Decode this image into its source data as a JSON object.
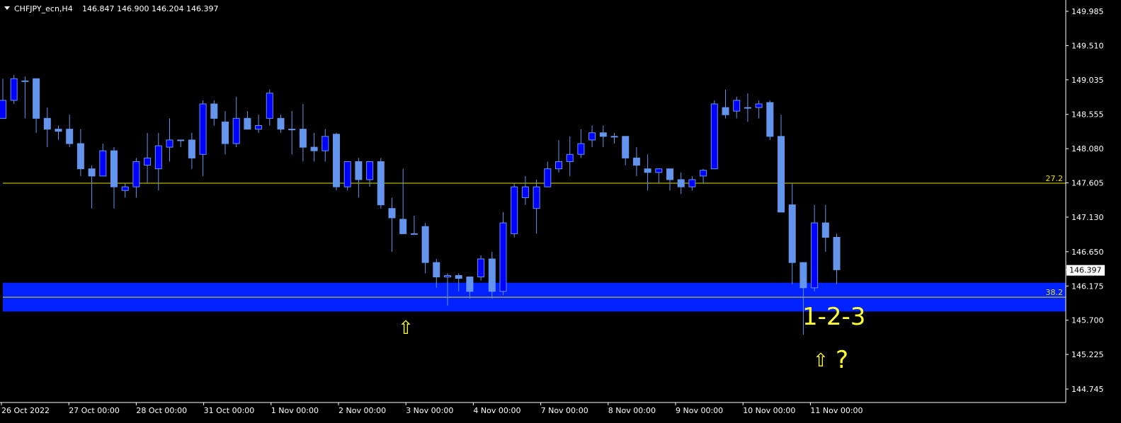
{
  "header": {
    "symbol": "CHFJPY_ecn,H4",
    "ohlc": "146.847 146.900 146.204 146.397"
  },
  "colors": {
    "background": "#000000",
    "bull_fill": "#0000ff",
    "bear_fill": "#6495ed",
    "wick": "#6495ed",
    "zone": "#0022ff",
    "level_line": "#e8e000",
    "annotation": "#ffff33",
    "axis": "#ffffff"
  },
  "annotations": {
    "pattern_label": "1-2-3",
    "question": "?",
    "arrow_glyph": "⇧"
  },
  "chart_data": {
    "type": "candlestick",
    "symbol": "CHFJPY_ecn",
    "timeframe": "H4",
    "ylim": [
      144.5,
      150.2
    ],
    "y_ticks": [
      "149.985",
      "149.510",
      "149.035",
      "148.555",
      "148.080",
      "147.605",
      "147.130",
      "146.650",
      "146.175",
      "145.700",
      "145.225",
      "144.745"
    ],
    "x_ticks": [
      "26 Oct 2022",
      "27 Oct 00:00",
      "28 Oct 00:00",
      "31 Oct 00:00",
      "1 Nov 00:00",
      "2 Nov 00:00",
      "3 Nov 00:00",
      "4 Nov 00:00",
      "7 Nov 00:00",
      "8 Nov 00:00",
      "9 Nov 00:00",
      "10 Nov 00:00",
      "11 Nov 00:00"
    ],
    "current_price": "146.397",
    "levels": [
      {
        "label": "27.2",
        "price": 147.6
      },
      {
        "label": "38.2",
        "price": 146.02
      }
    ],
    "zone": {
      "top": 146.22,
      "bottom": 145.82
    },
    "candles": [
      {
        "o": 148.5,
        "h": 149.05,
        "l": 148.5,
        "c": 148.75
      },
      {
        "o": 148.75,
        "h": 149.1,
        "l": 148.7,
        "c": 149.05
      },
      {
        "o": 149.02,
        "h": 149.08,
        "l": 148.5,
        "c": 149.02
      },
      {
        "o": 149.05,
        "h": 149.05,
        "l": 148.3,
        "c": 148.5
      },
      {
        "o": 148.5,
        "h": 148.65,
        "l": 148.1,
        "c": 148.35
      },
      {
        "o": 148.35,
        "h": 148.4,
        "l": 148.2,
        "c": 148.32
      },
      {
        "o": 148.35,
        "h": 148.55,
        "l": 148.1,
        "c": 148.15
      },
      {
        "o": 148.15,
        "h": 148.35,
        "l": 147.7,
        "c": 147.8
      },
      {
        "o": 147.8,
        "h": 147.85,
        "l": 147.25,
        "c": 147.7
      },
      {
        "o": 147.7,
        "h": 148.15,
        "l": 147.7,
        "c": 148.05
      },
      {
        "o": 148.05,
        "h": 148.1,
        "l": 147.25,
        "c": 147.55
      },
      {
        "o": 147.5,
        "h": 147.6,
        "l": 147.4,
        "c": 147.55
      },
      {
        "o": 147.55,
        "h": 147.95,
        "l": 147.4,
        "c": 147.9
      },
      {
        "o": 147.85,
        "h": 148.3,
        "l": 147.6,
        "c": 147.95
      },
      {
        "o": 147.8,
        "h": 148.3,
        "l": 147.5,
        "c": 148.12
      },
      {
        "o": 148.1,
        "h": 148.5,
        "l": 147.9,
        "c": 148.2
      },
      {
        "o": 148.2,
        "h": 148.2,
        "l": 148.1,
        "c": 148.2
      },
      {
        "o": 148.2,
        "h": 148.3,
        "l": 147.8,
        "c": 147.95
      },
      {
        "o": 148.0,
        "h": 148.75,
        "l": 147.7,
        "c": 148.7
      },
      {
        "o": 148.7,
        "h": 148.75,
        "l": 148.4,
        "c": 148.5
      },
      {
        "o": 148.45,
        "h": 148.6,
        "l": 148.0,
        "c": 148.15
      },
      {
        "o": 148.15,
        "h": 148.8,
        "l": 148.1,
        "c": 148.5
      },
      {
        "o": 148.5,
        "h": 148.6,
        "l": 148.35,
        "c": 148.35
      },
      {
        "o": 148.35,
        "h": 148.55,
        "l": 148.3,
        "c": 148.4
      },
      {
        "o": 148.5,
        "h": 148.9,
        "l": 148.4,
        "c": 148.85
      },
      {
        "o": 148.5,
        "h": 148.55,
        "l": 148.3,
        "c": 148.35
      },
      {
        "o": 148.35,
        "h": 148.6,
        "l": 148.0,
        "c": 148.35
      },
      {
        "o": 148.35,
        "h": 148.7,
        "l": 147.9,
        "c": 148.1
      },
      {
        "o": 148.1,
        "h": 148.3,
        "l": 147.9,
        "c": 148.05
      },
      {
        "o": 148.05,
        "h": 148.35,
        "l": 147.9,
        "c": 148.25
      },
      {
        "o": 148.28,
        "h": 148.3,
        "l": 147.5,
        "c": 147.55
      },
      {
        "o": 147.55,
        "h": 147.9,
        "l": 147.5,
        "c": 147.9
      },
      {
        "o": 147.9,
        "h": 147.95,
        "l": 147.4,
        "c": 147.65
      },
      {
        "o": 147.65,
        "h": 147.9,
        "l": 147.55,
        "c": 147.9
      },
      {
        "o": 147.9,
        "h": 147.95,
        "l": 147.25,
        "c": 147.3
      },
      {
        "o": 147.25,
        "h": 147.4,
        "l": 146.65,
        "c": 147.12
      },
      {
        "o": 147.1,
        "h": 147.8,
        "l": 146.95,
        "c": 146.9
      },
      {
        "o": 146.9,
        "h": 147.15,
        "l": 146.9,
        "c": 146.9
      },
      {
        "o": 147.0,
        "h": 147.05,
        "l": 146.35,
        "c": 146.5
      },
      {
        "o": 146.5,
        "h": 146.55,
        "l": 146.15,
        "c": 146.3
      },
      {
        "o": 146.3,
        "h": 146.35,
        "l": 145.9,
        "c": 146.32
      },
      {
        "o": 146.32,
        "h": 146.35,
        "l": 146.1,
        "c": 146.28
      },
      {
        "o": 146.3,
        "h": 146.3,
        "l": 146.0,
        "c": 146.1
      },
      {
        "o": 146.3,
        "h": 146.6,
        "l": 146.25,
        "c": 146.55
      },
      {
        "o": 146.55,
        "h": 146.65,
        "l": 146.0,
        "c": 146.1
      },
      {
        "o": 146.1,
        "h": 147.2,
        "l": 146.05,
        "c": 147.05
      },
      {
        "o": 146.9,
        "h": 147.6,
        "l": 146.85,
        "c": 147.55
      },
      {
        "o": 147.4,
        "h": 147.7,
        "l": 147.3,
        "c": 147.55
      },
      {
        "o": 147.25,
        "h": 147.65,
        "l": 146.9,
        "c": 147.55
      },
      {
        "o": 147.55,
        "h": 147.9,
        "l": 147.55,
        "c": 147.8
      },
      {
        "o": 147.8,
        "h": 148.2,
        "l": 147.75,
        "c": 147.9
      },
      {
        "o": 147.9,
        "h": 148.25,
        "l": 147.7,
        "c": 148.0
      },
      {
        "o": 148.0,
        "h": 148.35,
        "l": 147.95,
        "c": 148.15
      },
      {
        "o": 148.2,
        "h": 148.4,
        "l": 148.1,
        "c": 148.3
      },
      {
        "o": 148.3,
        "h": 148.4,
        "l": 148.1,
        "c": 148.25
      },
      {
        "o": 148.25,
        "h": 148.3,
        "l": 148.15,
        "c": 148.25
      },
      {
        "o": 148.25,
        "h": 148.25,
        "l": 147.85,
        "c": 147.95
      },
      {
        "o": 147.95,
        "h": 148.1,
        "l": 147.7,
        "c": 147.85
      },
      {
        "o": 147.8,
        "h": 148.0,
        "l": 147.5,
        "c": 147.75
      },
      {
        "o": 147.75,
        "h": 147.8,
        "l": 147.6,
        "c": 147.8
      },
      {
        "o": 147.8,
        "h": 147.8,
        "l": 147.5,
        "c": 147.65
      },
      {
        "o": 147.65,
        "h": 147.75,
        "l": 147.45,
        "c": 147.55
      },
      {
        "o": 147.55,
        "h": 147.7,
        "l": 147.5,
        "c": 147.65
      },
      {
        "o": 147.7,
        "h": 147.8,
        "l": 147.6,
        "c": 147.78
      },
      {
        "o": 147.8,
        "h": 148.75,
        "l": 147.8,
        "c": 148.7
      },
      {
        "o": 148.65,
        "h": 148.9,
        "l": 148.5,
        "c": 148.55
      },
      {
        "o": 148.6,
        "h": 148.8,
        "l": 148.5,
        "c": 148.75
      },
      {
        "o": 148.65,
        "h": 148.85,
        "l": 148.45,
        "c": 148.65
      },
      {
        "o": 148.65,
        "h": 148.75,
        "l": 148.5,
        "c": 148.7
      },
      {
        "o": 148.72,
        "h": 148.75,
        "l": 148.2,
        "c": 148.25
      },
      {
        "o": 148.25,
        "h": 148.55,
        "l": 147.2,
        "c": 147.2
      },
      {
        "o": 147.3,
        "h": 147.6,
        "l": 146.2,
        "c": 146.5
      },
      {
        "o": 146.5,
        "h": 146.5,
        "l": 145.5,
        "c": 146.15
      },
      {
        "o": 146.15,
        "h": 147.3,
        "l": 146.1,
        "c": 147.05
      },
      {
        "o": 147.05,
        "h": 147.3,
        "l": 146.65,
        "c": 146.85
      },
      {
        "o": 146.85,
        "h": 146.9,
        "l": 146.2,
        "c": 146.4
      }
    ]
  }
}
